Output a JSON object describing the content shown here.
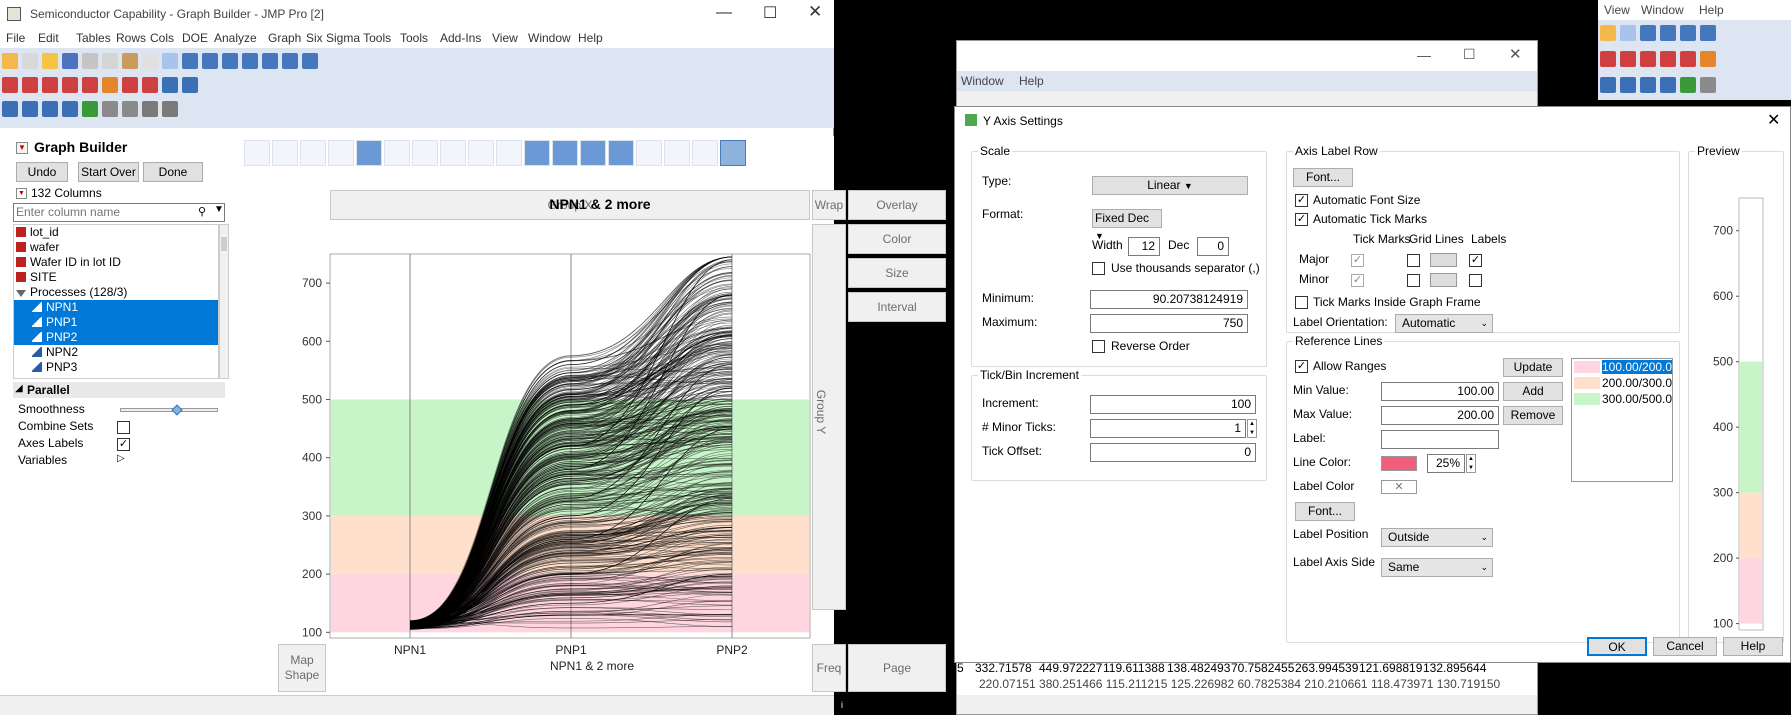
{
  "main_window": {
    "title": "Semiconductor Capability - Graph Builder - JMP Pro [2]",
    "menu": [
      "File",
      "Edit",
      "Tables",
      "Rows",
      "Cols",
      "DOE",
      "Analyze",
      "Graph",
      "Six Sigma Tools",
      "Tools",
      "Add-Ins",
      "View",
      "Window",
      "Help"
    ]
  },
  "graph_builder": {
    "title": "Graph Builder",
    "buttons": {
      "undo": "Undo",
      "start_over": "Start Over",
      "done": "Done"
    },
    "columns_count": "132 Columns",
    "search_placeholder": "Enter column name",
    "columns": [
      {
        "name": "lot_id",
        "selected": false,
        "indent": false
      },
      {
        "name": "wafer",
        "selected": false,
        "indent": false
      },
      {
        "name": "Wafer ID in lot ID",
        "selected": false,
        "indent": false
      },
      {
        "name": "SITE",
        "selected": false,
        "indent": false
      },
      {
        "name": "Processes (128/3)",
        "selected": false,
        "indent": false
      },
      {
        "name": "NPN1",
        "selected": true,
        "indent": true
      },
      {
        "name": "PNP1",
        "selected": true,
        "indent": true
      },
      {
        "name": "PNP2",
        "selected": true,
        "indent": true
      },
      {
        "name": "NPN2",
        "selected": false,
        "indent": true
      },
      {
        "name": "PNP3",
        "selected": false,
        "indent": true
      }
    ],
    "parallel": {
      "title": "Parallel",
      "smoothness": "Smoothness",
      "smoothness_value": 0.6,
      "combine_sets": "Combine Sets",
      "axes_labels": "Axes Labels",
      "variables": "Variables"
    },
    "zones": {
      "group_x": "Group X",
      "wrap": "Wrap",
      "overlay": "Overlay",
      "color": "Color",
      "size": "Size",
      "interval": "Interval",
      "group_y": "Group Y",
      "map_shape_1": "Map",
      "map_shape_2": "Shape",
      "freq": "Freq",
      "page": "Page"
    }
  },
  "chart_data": {
    "type": "line",
    "title": "NPN1 & 2 more",
    "xlabel": "NPN1 & 2 more",
    "categories": [
      "NPN1",
      "PNP1",
      "PNP2"
    ],
    "ylim": [
      90.20738124919,
      750
    ],
    "yticks": [
      100,
      200,
      300,
      400,
      500,
      600,
      700
    ],
    "reference_ranges": [
      {
        "min": 100,
        "max": 200,
        "color": "#ffd5e0"
      },
      {
        "min": 200,
        "max": 300,
        "color": "#ffe0cc"
      },
      {
        "min": 300,
        "max": 500,
        "color": "#c8f5c8"
      }
    ],
    "line_color": "#000000",
    "series_sample": [
      {
        "values": [
          110,
          420,
          740
        ]
      },
      {
        "values": [
          108,
          380,
          680
        ]
      },
      {
        "values": [
          112,
          330,
          560
        ]
      },
      {
        "values": [
          105,
          260,
          450
        ]
      },
      {
        "values": [
          115,
          200,
          330
        ]
      },
      {
        "values": [
          110,
          150,
          200
        ]
      },
      {
        "values": [
          107,
          130,
          130
        ]
      },
      {
        "values": [
          112,
          490,
          610
        ]
      },
      {
        "values": [
          110,
          300,
          520
        ]
      },
      {
        "values": [
          109,
          240,
          280
        ]
      }
    ]
  },
  "back_window": {
    "menu": [
      "Window",
      "Help"
    ]
  },
  "right_window": {
    "menu": [
      "View",
      "Window",
      "Help"
    ]
  },
  "dialog": {
    "title": "Y Axis Settings",
    "scale": {
      "title": "Scale",
      "type_label": "Type:",
      "type_value": "Linear",
      "format_label": "Format:",
      "format_value": "Fixed Dec",
      "width_label": "Width",
      "width_value": "12",
      "dec_label": "Dec",
      "dec_value": "0",
      "thousands": "Use thousands separator (,)",
      "min_label": "Minimum:",
      "min_value": "90.20738124919",
      "max_label": "Maximum:",
      "max_value": "750",
      "reverse": "Reverse Order"
    },
    "tick": {
      "title": "Tick/Bin Increment",
      "increment_label": "Increment:",
      "increment_value": "100",
      "minor_label": "# Minor Ticks:",
      "minor_value": "1",
      "offset_label": "Tick Offset:",
      "offset_value": "0"
    },
    "axis_label_row": {
      "title": "Axis Label Row",
      "font": "Font...",
      "auto_font": "Automatic Font Size",
      "auto_ticks": "Automatic Tick Marks",
      "tick_marks": "Tick Marks",
      "grid_lines": "Grid Lines",
      "labels": "Labels",
      "major": "Major",
      "minor": "Minor",
      "inside": "Tick Marks Inside Graph Frame",
      "orientation_label": "Label Orientation:",
      "orientation_value": "Automatic"
    },
    "reference_lines": {
      "title": "Reference Lines",
      "allow_ranges": "Allow Ranges",
      "min_label": "Min Value:",
      "min_value": "100.00",
      "max_label": "Max Value:",
      "max_value": "200.00",
      "label_label": "Label:",
      "label_value": "",
      "line_color_label": "Line Color:",
      "line_color": "#f0607a",
      "opacity": "25%",
      "label_color_label": "Label Color",
      "font": "Font...",
      "position_label": "Label Position",
      "position_value": "Outside",
      "axis_side_label": "Label Axis Side",
      "axis_side_value": "Same",
      "update": "Update",
      "add": "Add",
      "remove": "Remove",
      "items": [
        {
          "text": "100.00/200.0",
          "color": "#ffd5e0",
          "selected": true
        },
        {
          "text": "200.00/300.0",
          "color": "#ffe0cc",
          "selected": false
        },
        {
          "text": "300.00/500.0",
          "color": "#c8f5c8",
          "selected": false
        }
      ]
    },
    "preview": {
      "title": "Preview",
      "ticks": [
        "700",
        "600",
        "500",
        "400",
        "300",
        "200",
        "100"
      ]
    },
    "ok": "OK",
    "cancel": "Cancel",
    "help": "Help"
  },
  "background_table": {
    "row1": [
      "5",
      "332.71578",
      "449.972227",
      "119.611388",
      "138.482493",
      "70.7582455",
      "263.994539",
      "121.698819",
      "132.895644"
    ],
    "row2": "220.07151  380.251466  115.211215  125.226982  60.7825384  210.210661  118.473971  130.719150"
  }
}
